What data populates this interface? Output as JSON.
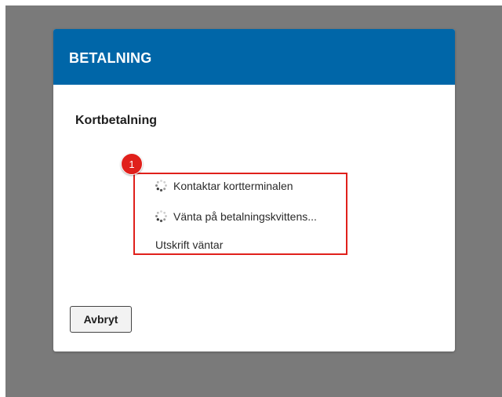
{
  "dialog": {
    "title": "BETALNING",
    "section_title": "Kortbetalning",
    "badge_number": "1",
    "status": [
      {
        "text": "Kontaktar kortterminalen",
        "icon": "spinner-icon"
      },
      {
        "text": "Vänta på betalningskvittens...",
        "icon": "spinner-icon"
      },
      {
        "text": "Utskrift väntar"
      }
    ],
    "cancel_label": "Avbryt"
  },
  "colors": {
    "header": "#0066a8",
    "overlay": "#7a7a7a",
    "highlight": "#e0201b"
  }
}
